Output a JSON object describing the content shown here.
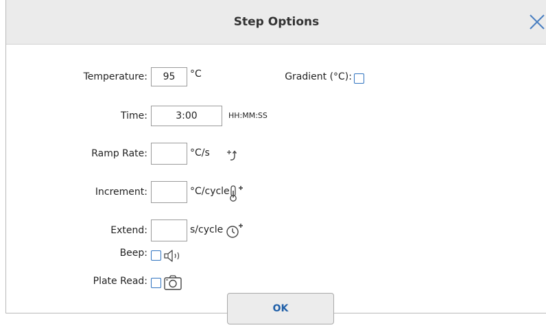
{
  "dialog": {
    "title": "Step Options",
    "ok_label": "OK"
  },
  "temperature": {
    "label": "Temperature:",
    "value": "95",
    "unit": "°C"
  },
  "gradient": {
    "label": "Gradient (°C):",
    "checked": false
  },
  "time": {
    "label": "Time:",
    "value": "3:00",
    "unit": "HH:MM:SS"
  },
  "ramp_rate": {
    "label": "Ramp Rate:",
    "value": "",
    "unit": "°C/s",
    "icon": "ramp-rate-icon"
  },
  "increment": {
    "label": "Increment:",
    "value": "",
    "unit": "°C/cycle",
    "icon": "thermometer-plus-icon"
  },
  "extend": {
    "label": "Extend:",
    "value": "",
    "unit": "s/cycle",
    "icon": "clock-plus-icon"
  },
  "beep": {
    "label": "Beep:",
    "checked": false,
    "icon": "speaker-icon"
  },
  "plate_read": {
    "label": "Plate Read:",
    "checked": false,
    "icon": "camera-icon"
  },
  "colors": {
    "accent": "#2f73c0",
    "title_bar": "#ebebeb",
    "ok_text": "#1f5fa8"
  }
}
